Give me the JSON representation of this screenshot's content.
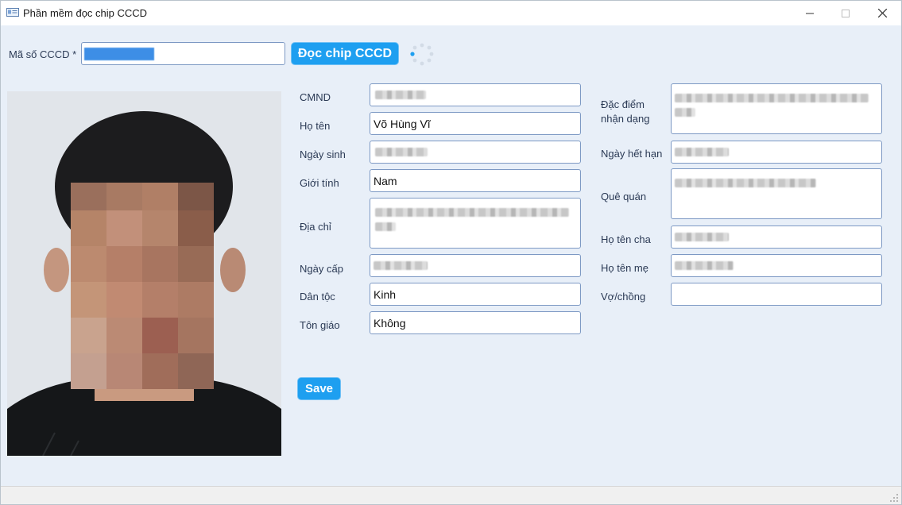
{
  "window": {
    "title": "Phần mềm đọc chip CCCD",
    "controls": [
      "minimize-icon",
      "maximize-icon",
      "close-icon"
    ]
  },
  "search": {
    "label": "Mã số CCCD *",
    "value": "",
    "read_button": "Đọc chip CCCD",
    "loading_icon": "spinner-icon"
  },
  "form": {
    "left": [
      {
        "label": "CMND",
        "value": ""
      },
      {
        "label": "Họ tên",
        "value": "Võ Hùng Vĩ"
      },
      {
        "label": "Ngày sinh",
        "value": ""
      },
      {
        "label": "Giới tính",
        "value": "Nam"
      },
      {
        "label": "Địa chỉ",
        "value": ""
      },
      {
        "label": "Ngày cấp",
        "value": ""
      },
      {
        "label": "Dân tộc",
        "value": "Kinh"
      },
      {
        "label": "Tôn giáo",
        "value": "Không"
      }
    ],
    "right": [
      {
        "label": "Đặc điểm nhận dạng",
        "value": ""
      },
      {
        "label": "Ngày hết hạn",
        "value": ""
      },
      {
        "label": "Quê quán",
        "value": ""
      },
      {
        "label": "Họ tên cha",
        "value": ""
      },
      {
        "label": "Họ tên mẹ",
        "value": ""
      },
      {
        "label": "Vợ/chồng",
        "value": ""
      }
    ],
    "save_button": "Save"
  },
  "colors": {
    "accent": "#1e9ff0",
    "window_bg": "#e8eff8",
    "label_text": "#2b3a55",
    "field_border": "#7d99c4"
  }
}
